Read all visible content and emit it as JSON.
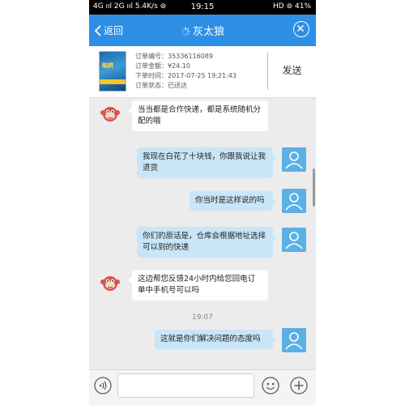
{
  "status_bar": {
    "left": "4G ııl 2G ııl 5.4K/s ⊚",
    "time": "19:15",
    "right": "HD ⊚ 41%"
  },
  "header": {
    "back_label": "返回",
    "title": "灰太狼"
  },
  "order": {
    "number": "订单编号：35336116089",
    "amount": "订单金额：¥24.10",
    "time": "下单时间：2017-07-25 19:21:43",
    "status": "订单状态：已送达",
    "send_label": "发送",
    "cover_text": "陷阱"
  },
  "messages": [
    {
      "side": "left",
      "text": "当当都是合作快递，都是系统随机分配的哦"
    },
    {
      "side": "right",
      "text": "我现在白花了十块钱，你跟我说让我退货"
    },
    {
      "side": "right",
      "text": "你当时是这样说的吗"
    },
    {
      "side": "right",
      "text": "你们的原话是，仓库会根据地址选择可以到的快递"
    },
    {
      "side": "left",
      "text": "这边帮您反馈24小时内给您回电订单中手机号可以吗"
    },
    {
      "side": "right",
      "text": "这就是你们解决问题的态度吗"
    }
  ],
  "timestamp": "19:07",
  "input": {
    "value": "",
    "placeholder": ""
  },
  "colors": {
    "header_bg": "#2d8fe6",
    "user_bubble": "#c8e6f7",
    "avatar_user": "#5bb0e4",
    "mascot_red": "#d9534f"
  }
}
